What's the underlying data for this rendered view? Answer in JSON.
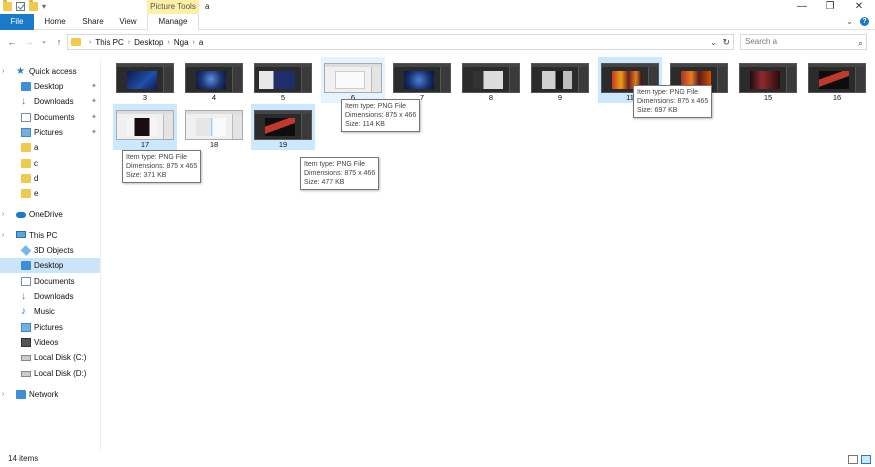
{
  "window": {
    "title": "a",
    "contextual_group": "Picture Tools",
    "minimize": "—",
    "maximize": "❐",
    "close": "✕"
  },
  "ribbon": {
    "tabs": [
      "File",
      "Home",
      "Share",
      "View",
      "Manage"
    ]
  },
  "address": {
    "crumbs": [
      "This PC",
      "Desktop",
      "Nga",
      "a"
    ],
    "search_placeholder": "Search a"
  },
  "sidebar": {
    "quick_access": "Quick access",
    "pinned": [
      "Desktop",
      "Downloads",
      "Documents",
      "Pictures"
    ],
    "recent": [
      "a",
      "c",
      "d",
      "e"
    ],
    "onedrive": "OneDrive",
    "this_pc": "This PC",
    "pc_items": [
      "3D Objects",
      "Desktop",
      "Documents",
      "Downloads",
      "Music",
      "Pictures",
      "Videos",
      "Local Disk (C:)",
      "Local Disk (D:)"
    ],
    "network": "Network"
  },
  "files": [
    {
      "name": "3"
    },
    {
      "name": "4"
    },
    {
      "name": "5"
    },
    {
      "name": "6"
    },
    {
      "name": "7"
    },
    {
      "name": "8"
    },
    {
      "name": "9"
    },
    {
      "name": "11"
    },
    {
      "name": "14"
    },
    {
      "name": "15"
    },
    {
      "name": "16"
    },
    {
      "name": "17"
    },
    {
      "name": "18"
    },
    {
      "name": "19"
    }
  ],
  "tooltips": [
    {
      "type": "Item type: PNG File",
      "dim": "Dimensions: 875 x 466",
      "size": "Size: 114 KB"
    },
    {
      "type": "Item type: PNG File",
      "dim": "Dimensions: 875 x 465",
      "size": "Size: 697 KB"
    },
    {
      "type": "Item type: PNG File",
      "dim": "Dimensions: 875 x 465",
      "size": "Size: 371 KB"
    },
    {
      "type": "Item type: PNG File",
      "dim": "Dimensions: 875 x 466",
      "size": "Size: 477 KB"
    }
  ],
  "status": {
    "count": "14 items"
  },
  "colors": {
    "accent": "#1979ca",
    "selection": "#cce8ff",
    "contextual": "#fcf0a6"
  }
}
